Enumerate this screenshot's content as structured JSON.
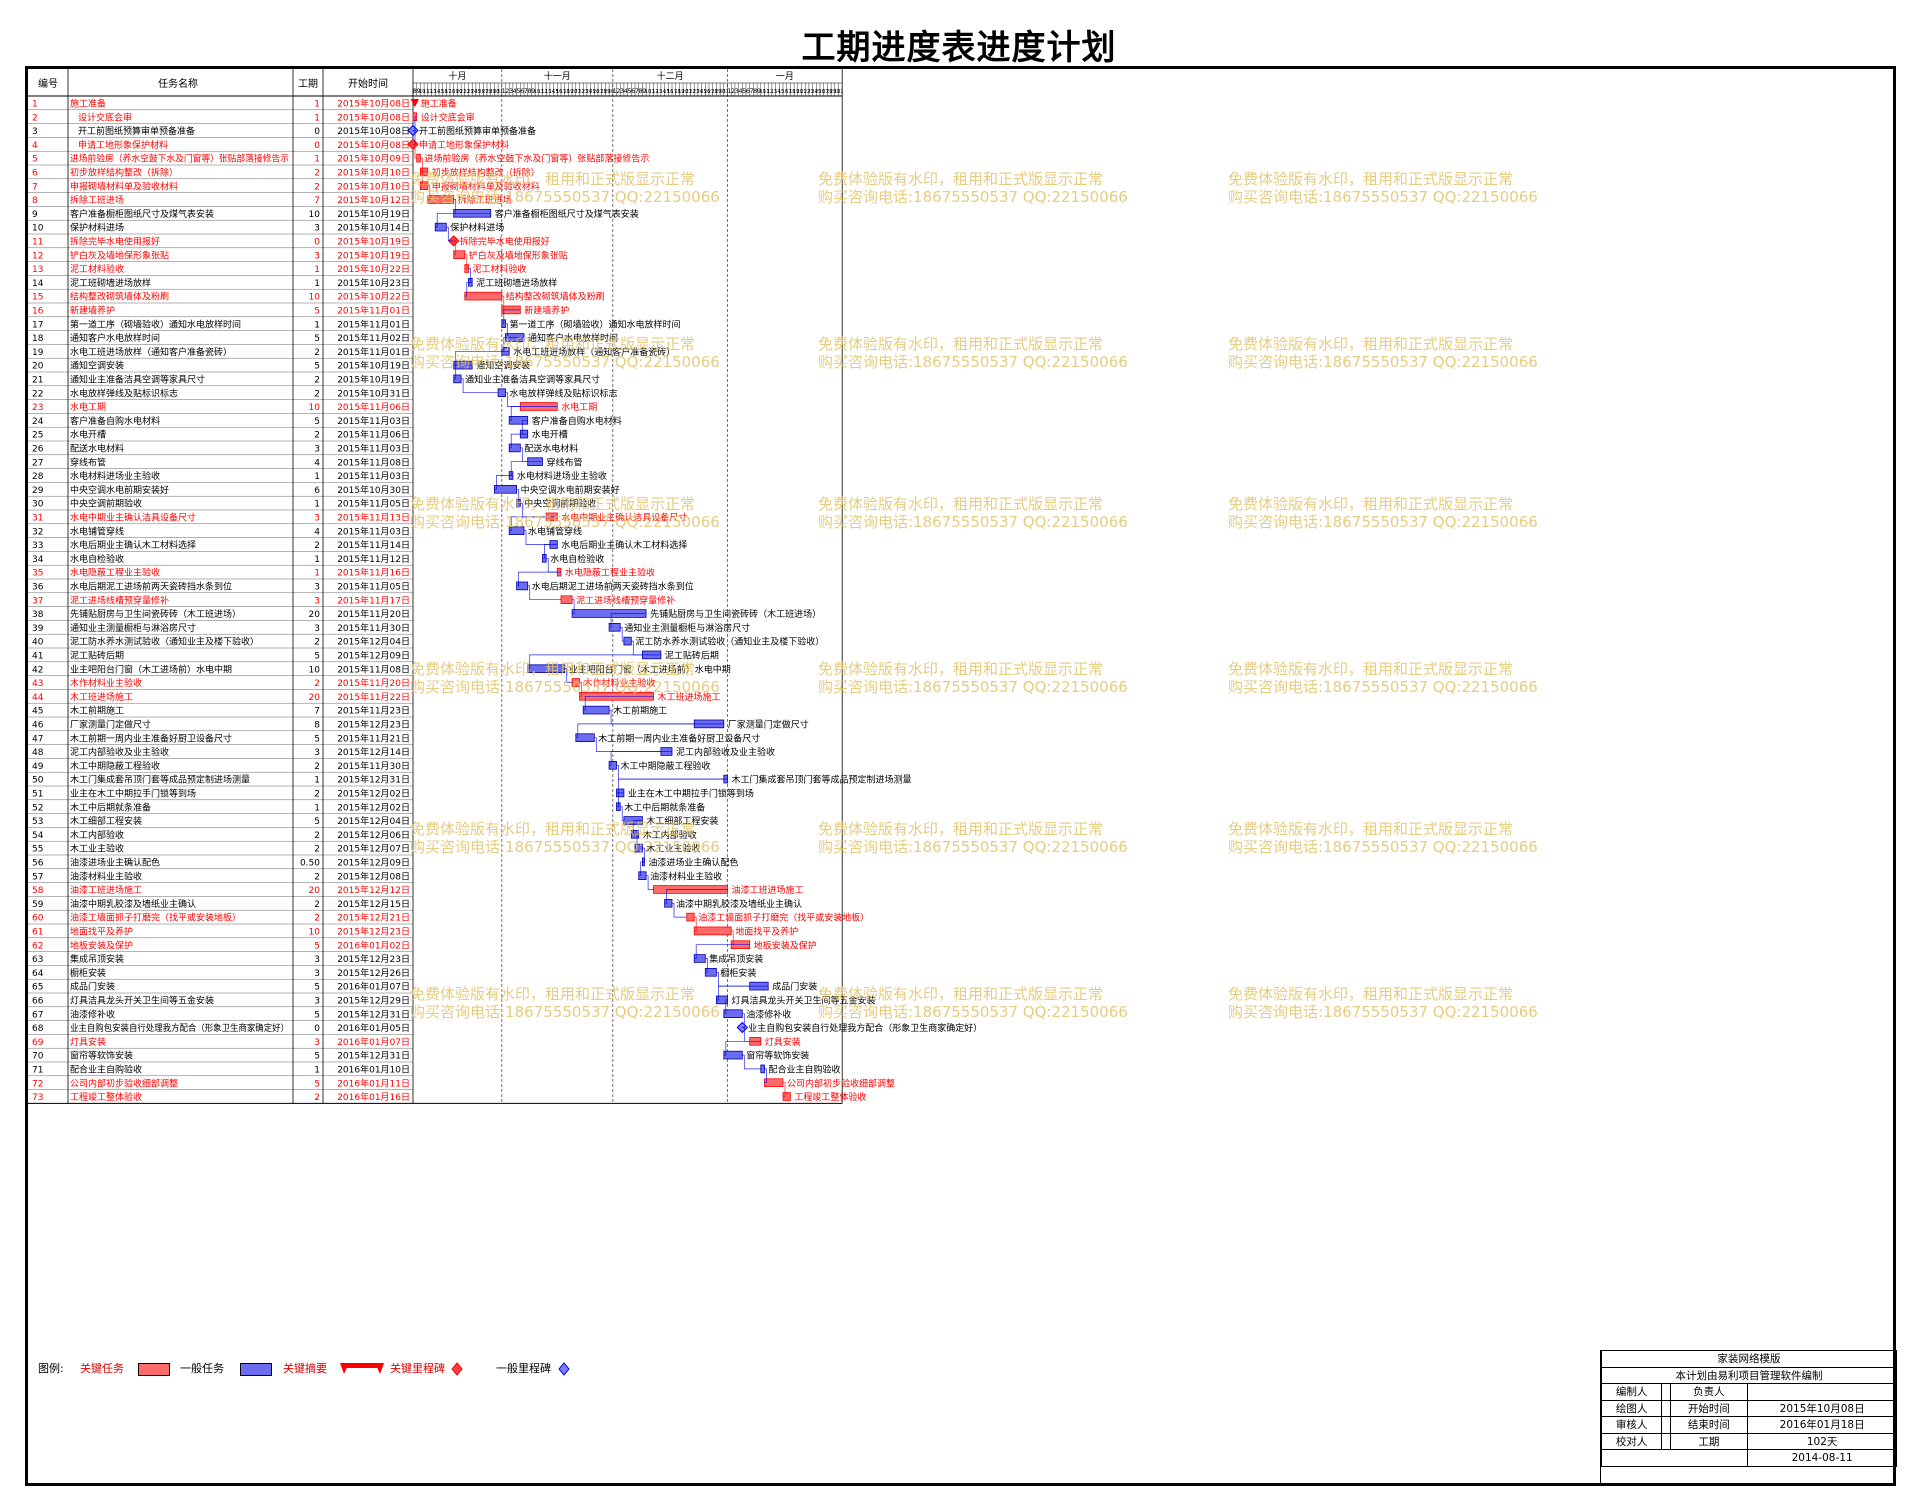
{
  "title": "工期进度表进度计划",
  "headers": {
    "id": "编号",
    "name": "任务名称",
    "dur": "工期",
    "start": "开始时间"
  },
  "months": [
    "十月",
    "十一月",
    "十二月",
    "一月"
  ],
  "month_lengths": [
    31,
    30,
    31,
    31
  ],
  "first_day": 8,
  "chart_data": {
    "type": "gantt",
    "start_date": "2015-10-08",
    "tasks": [
      {
        "id": "1",
        "name": "施工准备",
        "dur": "1",
        "start": "2015年10月08日",
        "crit": true,
        "ms": false
      },
      {
        "id": "2",
        "name": "设计交底会审",
        "dur": "1",
        "start": "2015年10月08日",
        "crit": true,
        "ms": false
      },
      {
        "id": "3",
        "name": "开工前图纸预算审单预备准备",
        "dur": "0",
        "start": "2015年10月08日",
        "crit": false,
        "ms": true
      },
      {
        "id": "4",
        "name": "申请工地形象保护材料",
        "dur": "0",
        "start": "2015年10月08日",
        "crit": true,
        "ms": true
      },
      {
        "id": "5",
        "name": "进场前验房（养水空鼓下水及门窗等）张贴部落接修告示",
        "dur": "1",
        "start": "2015年10月09日",
        "crit": true,
        "ms": false
      },
      {
        "id": "6",
        "name": "初步放样结构整改（拆除）",
        "dur": "2",
        "start": "2015年10月10日",
        "crit": true,
        "ms": false
      },
      {
        "id": "7",
        "name": "申报砌墙材料单及验收材料",
        "dur": "2",
        "start": "2015年10月10日",
        "crit": true,
        "ms": false
      },
      {
        "id": "8",
        "name": "拆除工班进场",
        "dur": "7",
        "start": "2015年10月12日",
        "crit": true,
        "ms": false
      },
      {
        "id": "9",
        "name": "客户准备橱柜图纸尺寸及煤气表安装",
        "dur": "10",
        "start": "2015年10月19日",
        "crit": false,
        "ms": false
      },
      {
        "id": "10",
        "name": "保护材料进场",
        "dur": "3",
        "start": "2015年10月14日",
        "crit": false,
        "ms": false
      },
      {
        "id": "11",
        "name": "拆除完毕水电使用报好",
        "dur": "0",
        "start": "2015年10月19日",
        "crit": true,
        "ms": true
      },
      {
        "id": "12",
        "name": "铲白灰及墙地保形象张贴",
        "dur": "3",
        "start": "2015年10月19日",
        "crit": true,
        "ms": false
      },
      {
        "id": "13",
        "name": "泥工材料验收",
        "dur": "1",
        "start": "2015年10月22日",
        "crit": true,
        "ms": false
      },
      {
        "id": "14",
        "name": "泥工班砌墙进场放样",
        "dur": "1",
        "start": "2015年10月23日",
        "crit": false,
        "ms": false
      },
      {
        "id": "15",
        "name": "结构整改砌筑墙体及粉刷",
        "dur": "10",
        "start": "2015年10月22日",
        "crit": true,
        "ms": false
      },
      {
        "id": "16",
        "name": "新建墙养护",
        "dur": "5",
        "start": "2015年11月01日",
        "crit": true,
        "ms": false
      },
      {
        "id": "17",
        "name": "第一道工序（砌墙验收）通知水电放样时间",
        "dur": "1",
        "start": "2015年11月01日",
        "crit": false,
        "ms": false
      },
      {
        "id": "18",
        "name": "通知客户水电放样时间",
        "dur": "5",
        "start": "2015年11月02日",
        "crit": false,
        "ms": false
      },
      {
        "id": "19",
        "name": "水电工班进场放样（通知客户准备瓷砖）",
        "dur": "2",
        "start": "2015年11月01日",
        "crit": false,
        "ms": false
      },
      {
        "id": "20",
        "name": "通知空调安装",
        "dur": "5",
        "start": "2015年10月19日",
        "crit": false,
        "ms": false
      },
      {
        "id": "21",
        "name": "通知业主准备洁具空调等家具尺寸",
        "dur": "2",
        "start": "2015年10月19日",
        "crit": false,
        "ms": false
      },
      {
        "id": "22",
        "name": "水电放样弹线及贴标识标志",
        "dur": "2",
        "start": "2015年10月31日",
        "crit": false,
        "ms": false
      },
      {
        "id": "23",
        "name": "水电工期",
        "dur": "10",
        "start": "2015年11月06日",
        "crit": true,
        "ms": false
      },
      {
        "id": "24",
        "name": "客户准备自购水电材料",
        "dur": "5",
        "start": "2015年11月03日",
        "crit": false,
        "ms": false
      },
      {
        "id": "25",
        "name": "水电开槽",
        "dur": "2",
        "start": "2015年11月06日",
        "crit": false,
        "ms": false
      },
      {
        "id": "26",
        "name": "配送水电材料",
        "dur": "3",
        "start": "2015年11月03日",
        "crit": false,
        "ms": false
      },
      {
        "id": "27",
        "name": "穿线布管",
        "dur": "4",
        "start": "2015年11月08日",
        "crit": false,
        "ms": false
      },
      {
        "id": "28",
        "name": "水电材料进场业主验收",
        "dur": "1",
        "start": "2015年11月03日",
        "crit": false,
        "ms": false
      },
      {
        "id": "29",
        "name": "中央空调水电前期安装好",
        "dur": "6",
        "start": "2015年10月30日",
        "crit": false,
        "ms": false
      },
      {
        "id": "30",
        "name": "中央空调前期验收",
        "dur": "1",
        "start": "2015年11月05日",
        "crit": false,
        "ms": false
      },
      {
        "id": "31",
        "name": "水电中期业主确认洁具设备尺寸",
        "dur": "3",
        "start": "2015年11月13日",
        "crit": true,
        "ms": false
      },
      {
        "id": "32",
        "name": "水电铺管穿线",
        "dur": "4",
        "start": "2015年11月03日",
        "crit": false,
        "ms": false
      },
      {
        "id": "33",
        "name": "水电后期业主确认木工材料选择",
        "dur": "2",
        "start": "2015年11月14日",
        "crit": false,
        "ms": false
      },
      {
        "id": "34",
        "name": "水电自检验收",
        "dur": "1",
        "start": "2015年11月12日",
        "crit": false,
        "ms": false
      },
      {
        "id": "35",
        "name": "水电隐蔽工程业主验收",
        "dur": "1",
        "start": "2015年11月16日",
        "crit": true,
        "ms": false
      },
      {
        "id": "36",
        "name": "水电后期泥工进场前两天瓷砖挡水条到位",
        "dur": "3",
        "start": "2015年11月05日",
        "crit": false,
        "ms": false
      },
      {
        "id": "37",
        "name": "泥工进场线槽预穿量修补",
        "dur": "3",
        "start": "2015年11月17日",
        "crit": true,
        "ms": false
      },
      {
        "id": "38",
        "name": "先铺贴厨房与卫生间瓷砖砖（木工班进场）",
        "dur": "20",
        "start": "2015年11月20日",
        "crit": false,
        "ms": false
      },
      {
        "id": "39",
        "name": "通知业主测量橱柜与淋浴房尺寸",
        "dur": "3",
        "start": "2015年11月30日",
        "crit": false,
        "ms": false
      },
      {
        "id": "40",
        "name": "泥工防水养水测试验收（通知业主及楼下验收）",
        "dur": "2",
        "start": "2015年12月04日",
        "crit": false,
        "ms": false
      },
      {
        "id": "41",
        "name": "泥工贴砖后期",
        "dur": "5",
        "start": "2015年12月09日",
        "crit": false,
        "ms": false
      },
      {
        "id": "42",
        "name": "业主吧阳台门窗（木工进场前）水电中期",
        "dur": "10",
        "start": "2015年11月08日",
        "crit": false,
        "ms": false
      },
      {
        "id": "43",
        "name": "木作材料业主验收",
        "dur": "2",
        "start": "2015年11月20日",
        "crit": true,
        "ms": false
      },
      {
        "id": "44",
        "name": "木工班进场施工",
        "dur": "20",
        "start": "2015年11月22日",
        "crit": true,
        "ms": false
      },
      {
        "id": "45",
        "name": "木工前期施工",
        "dur": "7",
        "start": "2015年11月23日",
        "crit": false,
        "ms": false
      },
      {
        "id": "46",
        "name": "厂家测量门定做尺寸",
        "dur": "8",
        "start": "2015年12月23日",
        "crit": false,
        "ms": false
      },
      {
        "id": "47",
        "name": "木工前期一周内业主准备好厨卫设备尺寸",
        "dur": "5",
        "start": "2015年11月21日",
        "crit": false,
        "ms": false
      },
      {
        "id": "48",
        "name": "泥工内部验收及业主验收",
        "dur": "3",
        "start": "2015年12月14日",
        "crit": false,
        "ms": false
      },
      {
        "id": "49",
        "name": "木工中期隐蔽工程验收",
        "dur": "2",
        "start": "2015年11月30日",
        "crit": false,
        "ms": false
      },
      {
        "id": "50",
        "name": "木工门集成套吊顶门套等成品预定制进场测量",
        "dur": "1",
        "start": "2015年12月31日",
        "crit": false,
        "ms": false
      },
      {
        "id": "51",
        "name": "业主在木工中期拉手门锁等到场",
        "dur": "2",
        "start": "2015年12月02日",
        "crit": false,
        "ms": false
      },
      {
        "id": "52",
        "name": "木工中后期就条准备",
        "dur": "1",
        "start": "2015年12月02日",
        "crit": false,
        "ms": false
      },
      {
        "id": "53",
        "name": "木工细部工程安装",
        "dur": "5",
        "start": "2015年12月04日",
        "crit": false,
        "ms": false
      },
      {
        "id": "54",
        "name": "木工内部验收",
        "dur": "2",
        "start": "2015年12月06日",
        "crit": false,
        "ms": false
      },
      {
        "id": "55",
        "name": "木工业主验收",
        "dur": "2",
        "start": "2015年12月07日",
        "crit": false,
        "ms": false
      },
      {
        "id": "56",
        "name": "油漆进场业主确认配色",
        "dur": "0.50",
        "start": "2015年12月09日",
        "crit": false,
        "ms": false
      },
      {
        "id": "57",
        "name": "油漆材料业主验收",
        "dur": "2",
        "start": "2015年12月08日",
        "crit": false,
        "ms": false
      },
      {
        "id": "58",
        "name": "油漆工班进场施工",
        "dur": "20",
        "start": "2015年12月12日",
        "crit": true,
        "ms": false
      },
      {
        "id": "59",
        "name": "油漆中期乳胶漆及墙纸业主确认",
        "dur": "2",
        "start": "2015年12月15日",
        "crit": false,
        "ms": false
      },
      {
        "id": "60",
        "name": "油漆工墙面抓子打磨完（找平或安装地板）",
        "dur": "2",
        "start": "2015年12月21日",
        "crit": true,
        "ms": false
      },
      {
        "id": "61",
        "name": "地面找平及养护",
        "dur": "10",
        "start": "2015年12月23日",
        "crit": true,
        "ms": false
      },
      {
        "id": "62",
        "name": "地板安装及保护",
        "dur": "5",
        "start": "2016年01月02日",
        "crit": true,
        "ms": false
      },
      {
        "id": "63",
        "name": "集成吊顶安装",
        "dur": "3",
        "start": "2015年12月23日",
        "crit": false,
        "ms": false
      },
      {
        "id": "64",
        "name": "橱柜安装",
        "dur": "3",
        "start": "2015年12月26日",
        "crit": false,
        "ms": false
      },
      {
        "id": "65",
        "name": "成品门安装",
        "dur": "5",
        "start": "2016年01月07日",
        "crit": false,
        "ms": false
      },
      {
        "id": "66",
        "name": "灯具洁具龙头开关卫生间等五金安装",
        "dur": "3",
        "start": "2015年12月29日",
        "crit": false,
        "ms": false
      },
      {
        "id": "67",
        "name": "油漆修补收",
        "dur": "5",
        "start": "2015年12月31日",
        "crit": false,
        "ms": false
      },
      {
        "id": "68",
        "name": "业主自购包安装自行处理我方配合（形象卫生商家确定好）",
        "dur": "0",
        "start": "2016年01月05日",
        "crit": false,
        "ms": true
      },
      {
        "id": "69",
        "name": "灯具安装",
        "dur": "3",
        "start": "2016年01月07日",
        "crit": true,
        "ms": false
      },
      {
        "id": "70",
        "name": "窗帘等软饰安装",
        "dur": "5",
        "start": "2015年12月31日",
        "crit": false,
        "ms": false
      },
      {
        "id": "71",
        "name": "配合业主自购验收",
        "dur": "1",
        "start": "2016年01月10日",
        "crit": false,
        "ms": false
      },
      {
        "id": "72",
        "name": "公司内部初步验收细部调整",
        "dur": "5",
        "start": "2016年01月11日",
        "crit": true,
        "ms": false
      },
      {
        "id": "73",
        "name": "工程竣工整体验收",
        "dur": "2",
        "start": "2016年01月16日",
        "crit": true,
        "ms": false
      }
    ]
  },
  "watermark": {
    "line1": "免费体验版有水印，租用和正式版显示正常",
    "line2": "购买咨询电话:18675550537 QQ:22150066"
  },
  "legend": {
    "label": "图例:",
    "crit_task": "关键任务",
    "normal_task": "一般任务",
    "crit_summary": "关键摘要",
    "crit_milestone": "关键里程碑",
    "normal_milestone": "一般里程碑"
  },
  "infobox": {
    "title1": "家装网络模版",
    "title2": "本计划由易利项目管理软件编制",
    "rows": [
      {
        "l1": "编制人",
        "v1": "",
        "l2": "负责人",
        "v2": ""
      },
      {
        "l1": "绘图人",
        "v1": "",
        "l2": "开始时间",
        "v2": "2015年10月08日"
      },
      {
        "l1": "审核人",
        "v1": "",
        "l2": "结束时间",
        "v2": "2016年01月18日"
      },
      {
        "l1": "校对人",
        "v1": "",
        "l2": "工期",
        "v2": "102天"
      }
    ],
    "date": "2014-08-11"
  },
  "colors": {
    "critical": "#ff0000",
    "critical_fill": "#ff6b6b",
    "normal_fill": "#6c6cf0",
    "normal_line": "#0000ee",
    "watermark": "#e2c46a"
  }
}
